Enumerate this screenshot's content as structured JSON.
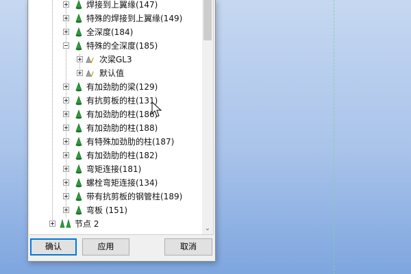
{
  "tree": {
    "items": [
      {
        "label": "焊接到上翼缘(147)"
      },
      {
        "label": "特殊的焊接到上翼缘(149)"
      },
      {
        "label": "全深度(184)"
      },
      {
        "label": "特殊的全深度(185)"
      },
      {
        "label": "次梁GL3"
      },
      {
        "label": "默认值"
      },
      {
        "label": "有加劲肋的梁(129)"
      },
      {
        "label": "有抗剪板的柱(131)"
      },
      {
        "label": "有加劲肋的柱(186)"
      },
      {
        "label": "有加劲肋的柱(188)"
      },
      {
        "label": "有特殊加劲肋的柱(187)"
      },
      {
        "label": "有加劲肋的柱(182)"
      },
      {
        "label": "弯矩连接(181)"
      },
      {
        "label": "螺栓弯矩连接(134)"
      },
      {
        "label": "带有抗剪板的钢管柱(189)"
      },
      {
        "label": "弯板 (151)"
      },
      {
        "label": "节点 2"
      }
    ]
  },
  "buttons": {
    "confirm": "确认",
    "apply": "应用",
    "cancel": "取消"
  },
  "colors": {
    "cone_green": "#2e9f3a",
    "primary_border": "#0078d7"
  }
}
